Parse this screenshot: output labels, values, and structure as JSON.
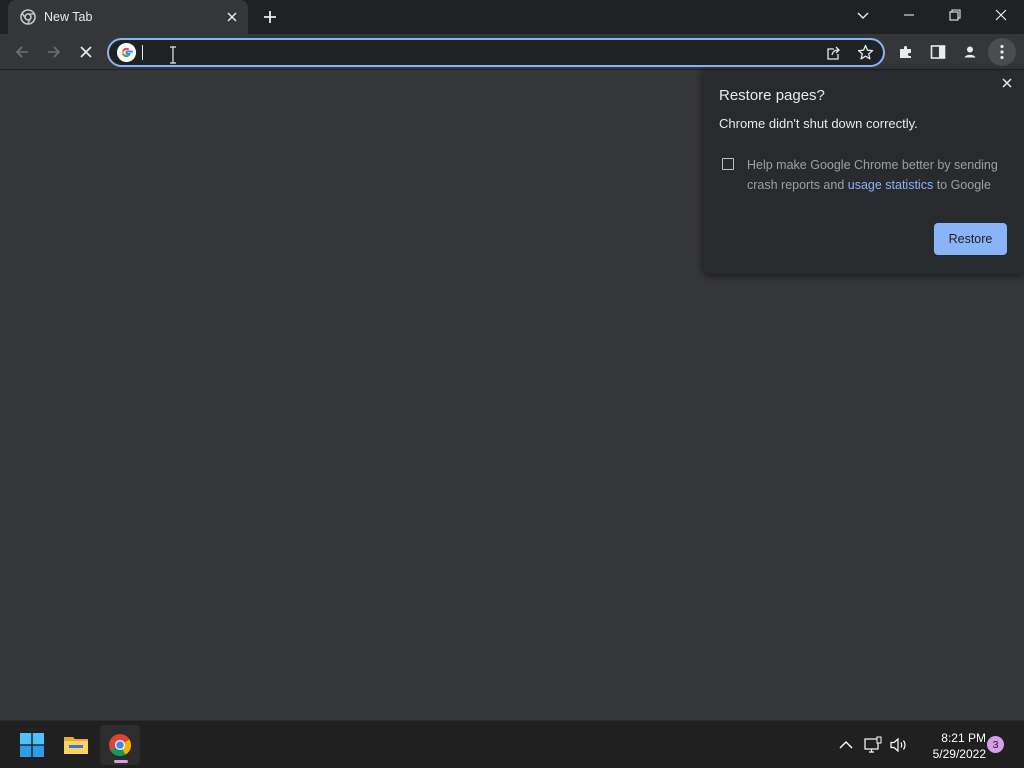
{
  "browser": {
    "tab": {
      "title": "New Tab"
    },
    "omnibox": {
      "value": ""
    }
  },
  "popup": {
    "title": "Restore pages?",
    "message": "Chrome didn't shut down correctly.",
    "help_text_before": "Help make Google Chrome better by sending crash reports and ",
    "help_link": "usage statistics",
    "help_text_after": " to Google",
    "checkbox_checked": false,
    "restore_label": "Restore"
  },
  "taskbar": {
    "apps": [
      "start-icon",
      "file-explorer-icon",
      "chrome-icon"
    ],
    "active_app": "chrome",
    "time": "8:21 PM",
    "date": "5/29/2022",
    "notification_count": "3"
  },
  "colors": {
    "accent": "#8ab4f8",
    "page_background": "#35363a",
    "badge": "#d59ee6"
  }
}
